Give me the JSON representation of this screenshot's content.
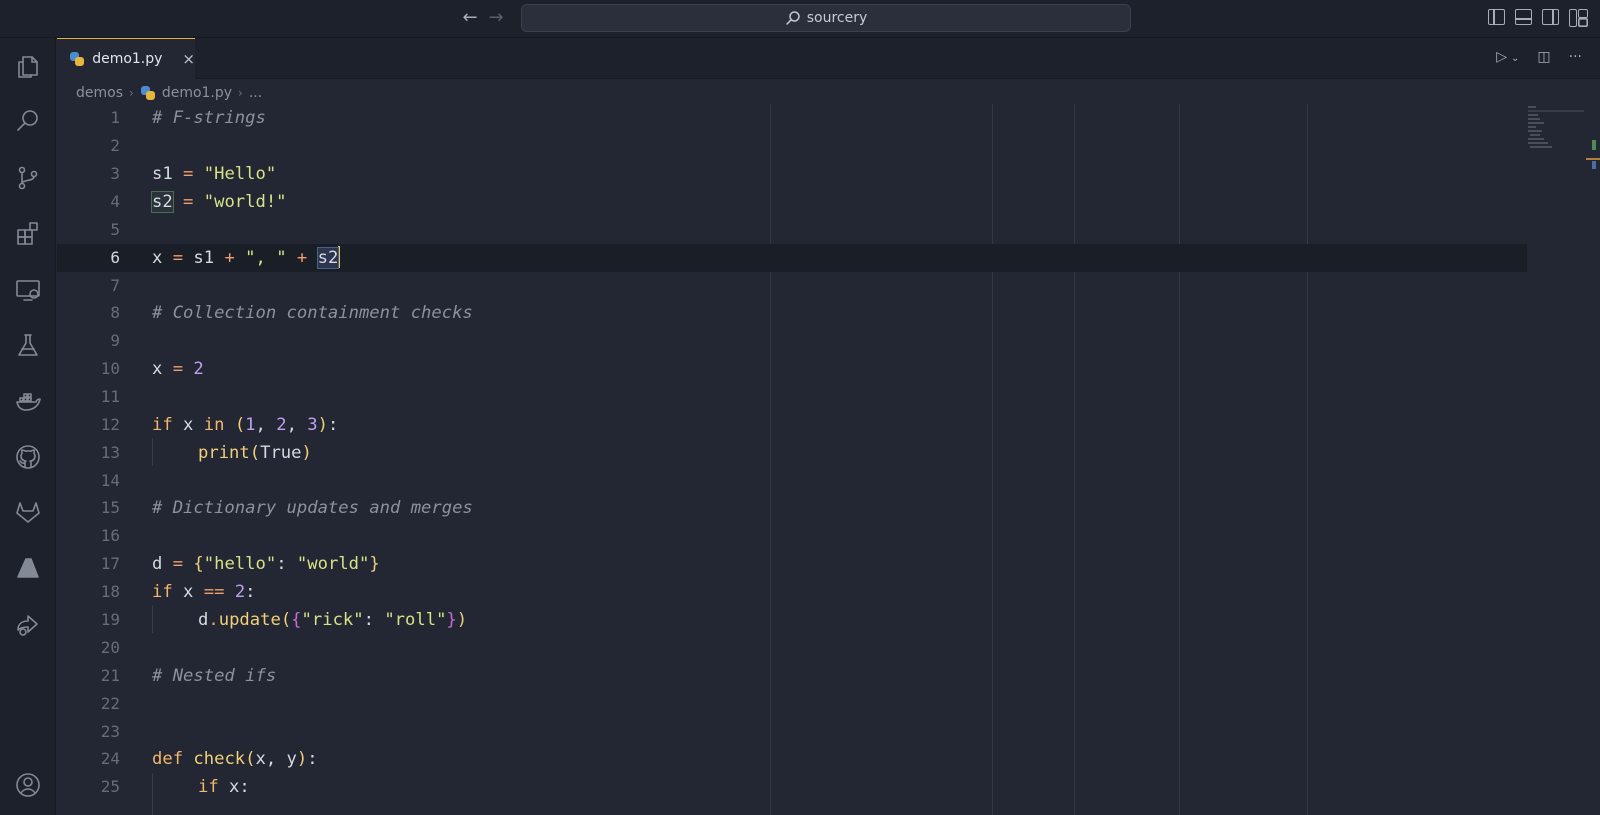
{
  "titlebar": {
    "search_label": "sourcery",
    "back_icon": "arrow-left-icon",
    "forward_icon": "arrow-right-icon"
  },
  "activity_bar": {
    "items": [
      "explorer-icon",
      "search-icon",
      "source-control-icon",
      "extensions-icon",
      "remote-explorer-icon",
      "testing-icon",
      "docker-icon",
      "github-icon",
      "gitlab-icon",
      "azure-icon",
      "live-share-icon"
    ],
    "bottom": [
      "account-icon"
    ]
  },
  "tabs": [
    {
      "label": "demo1.py",
      "active": true,
      "close": "×"
    }
  ],
  "breadcrumb": {
    "folder": "demos",
    "file": "demo1.py",
    "more": "..."
  },
  "editor": {
    "current_line": 6,
    "lines": [
      {
        "n": "1"
      },
      {
        "n": "2"
      },
      {
        "n": "3"
      },
      {
        "n": "4"
      },
      {
        "n": "5"
      },
      {
        "n": "6"
      },
      {
        "n": "7"
      },
      {
        "n": "8"
      },
      {
        "n": "9"
      },
      {
        "n": "10"
      },
      {
        "n": "11"
      },
      {
        "n": "12"
      },
      {
        "n": "13"
      },
      {
        "n": "14"
      },
      {
        "n": "15"
      },
      {
        "n": "16"
      },
      {
        "n": "17"
      },
      {
        "n": "18"
      },
      {
        "n": "19"
      },
      {
        "n": "20"
      },
      {
        "n": "21"
      },
      {
        "n": "22"
      },
      {
        "n": "23"
      },
      {
        "n": "24"
      },
      {
        "n": "25"
      }
    ],
    "code": {
      "l1_comment": "# F-strings",
      "l3_var": "s1",
      "l3_eq": " = ",
      "l3_str": "\"Hello\"",
      "l4_var": "s2",
      "l4_eq": " = ",
      "l4_str": "\"world!\"",
      "l6_a": "x",
      "l6_eq": " = ",
      "l6_b": "s1",
      "l6_plus1": " + ",
      "l6_str": "\", \"",
      "l6_plus2": " + ",
      "l6_c": "s2",
      "l8_comment": "# Collection containment checks",
      "l10_a": "x",
      "l10_eq": " = ",
      "l10_num": "2",
      "l12_if": "if",
      "l12_x": " x ",
      "l12_in": "in",
      "l12_sp": " ",
      "l12_po": "(",
      "l12_n1": "1",
      "l12_c1": ", ",
      "l12_n2": "2",
      "l12_c2": ", ",
      "l12_n3": "3",
      "l12_pc": ")",
      "l12_colon": ":",
      "l13_fn": "print",
      "l13_po": "(",
      "l13_arg": "True",
      "l13_pc": ")",
      "l15_comment": "# Dictionary updates and merges",
      "l17_d": "d",
      "l17_eq": " = ",
      "l17_bo": "{",
      "l17_k": "\"hello\"",
      "l17_colon": ": ",
      "l17_v": "\"world\"",
      "l17_bc": "}",
      "l18_if": "if",
      "l18_x": " x ",
      "l18_eqeq": "==",
      "l18_sp": " ",
      "l18_num": "2",
      "l18_colon": ":",
      "l19_d": "d",
      "l19_dot": ".",
      "l19_fn": "update",
      "l19_po": "(",
      "l19_bo": "{",
      "l19_k": "\"rick\"",
      "l19_colon": ": ",
      "l19_v": "\"roll\"",
      "l19_bc": "}",
      "l19_pc": ")",
      "l21_comment": "# Nested ifs",
      "l24_def": "def",
      "l24_sp": " ",
      "l24_fn": "check",
      "l24_po": "(",
      "l24_args": "x, y",
      "l24_pc": ")",
      "l24_colon": ":",
      "l25_if": "if",
      "l25_x": " x",
      "l25_colon": ":"
    }
  },
  "colors": {
    "accent_tab": "#e5b53c",
    "comment": "#8c919c",
    "string": "#d6e287",
    "keyword": "#f5b56a",
    "number": "#c0a0f0"
  }
}
